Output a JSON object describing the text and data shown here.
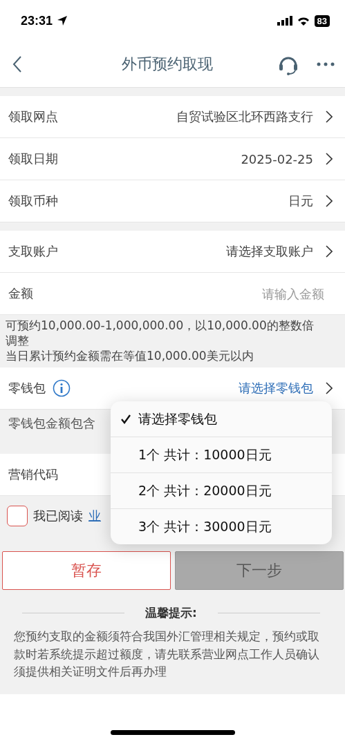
{
  "status_bar": {
    "time": "23:31",
    "battery": "83"
  },
  "nav": {
    "title": "外币预约取现"
  },
  "sections": [
    [
      {
        "label": "领取网点",
        "value": "自贸试验区北环西路支行"
      },
      {
        "label": "领取日期",
        "value": "2025-02-25"
      },
      {
        "label": "领取币种",
        "value": "日元"
      }
    ],
    [
      {
        "label": "支取账户",
        "value": "请选择支取账户",
        "kind": "select"
      },
      {
        "label": "金额",
        "placeholder": "请输入金额",
        "kind": "input"
      }
    ]
  ],
  "amount_notes": [
    "可预约10,000.00-1,000,000.00，以10,000.00的整数倍调整",
    "当日累计预约金额需在等值10,000.00美元以内"
  ],
  "wallet": {
    "label": "零钱包",
    "value": "请选择零钱包"
  },
  "wallet_note": "零钱包金额包含",
  "marketing": {
    "label": "营销代码"
  },
  "agreement": {
    "checked": false,
    "text": "我已阅读",
    "link": "业"
  },
  "buttons": [
    {
      "label": "暂存",
      "kind": "outline"
    },
    {
      "label": "下一步",
      "kind": "disabled"
    }
  ],
  "tips": {
    "title": "温馨提示:",
    "body": "您预约支取的金额须符合我国外汇管理相关规定，预约或取款时若系统提示超过额度，请先联系营业网点工作人员确认须提供相关证明文件后再办理"
  },
  "popup_menu": [
    {
      "label": "请选择零钱包",
      "selected": true
    },
    {
      "label": "1个  共计：10000日元",
      "selected": false
    },
    {
      "label": "2个  共计：20000日元",
      "selected": false
    },
    {
      "label": "3个  共计：30000日元",
      "selected": false
    }
  ]
}
